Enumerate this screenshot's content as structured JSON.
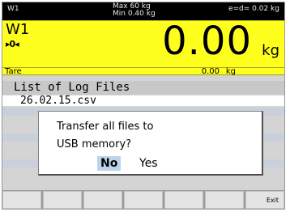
{
  "topbar": {
    "scale_id": "W1",
    "max": "Max 60 kg",
    "min": "Min 0.40 kg",
    "resolution": "e=d= 0.02 kg"
  },
  "weight": {
    "scale_id": "W1",
    "zero_indicator": "▸0◂",
    "value": "0.00",
    "unit": "kg",
    "tare_label": "Tare",
    "tare_value": "0.00",
    "tare_unit": "kg"
  },
  "list": {
    "title": "List of Log Files",
    "files": [
      "26.02.15.csv"
    ]
  },
  "dialog": {
    "message_line1": "Transfer all files to",
    "message_line2": "USB memory?",
    "no_label": "No",
    "yes_label": "Yes"
  },
  "softkeys": [
    "",
    "",
    "",
    "",
    "",
    "",
    "Exit"
  ]
}
